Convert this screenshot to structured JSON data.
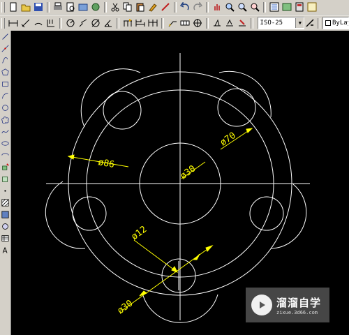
{
  "toolbar_dims": {
    "dimstyle_value": "ISO-25",
    "layer_value": "ByLay"
  },
  "drawing": {
    "dimensions": {
      "d86": "ø86",
      "d70": "ø70",
      "d30_center": "ø30",
      "d12": "ø12",
      "d30_bottom": "ø30"
    }
  },
  "watermark": {
    "brand": "溜溜自学",
    "url": "zixue.3d66.com"
  },
  "icons": {
    "standard_toolbar": [
      "new-icon",
      "open-icon",
      "save-icon",
      "print-icon",
      "print-preview-icon",
      "publish-icon",
      "3d-publish-icon",
      "cut-icon",
      "copy-icon",
      "paste-icon",
      "match-properties-icon",
      "block-editor-icon",
      "undo-icon",
      "redo-icon",
      "pan-icon",
      "zoom-realtime-icon",
      "zoom-window-icon",
      "zoom-previous-icon",
      "properties-icon",
      "design-center-icon",
      "tool-palettes-icon",
      "sheet-set-icon"
    ],
    "dim_toolbar": [
      "linear-dim-icon",
      "aligned-dim-icon",
      "arc-length-icon",
      "ordinate-dim-icon",
      "radius-dim-icon",
      "jogged-dim-icon",
      "diameter-dim-icon",
      "angular-dim-icon",
      "quick-dim-icon",
      "baseline-dim-icon",
      "continue-dim-icon",
      "leader-icon",
      "tolerance-icon",
      "center-mark-icon",
      "dim-edit-icon",
      "dim-text-edit-icon",
      "dim-update-icon",
      "dim-style-icon"
    ],
    "draw_toolbar": [
      "line-icon",
      "construction-line-icon",
      "polyline-icon",
      "polygon-icon",
      "rectangle-icon",
      "arc-icon",
      "circle-icon",
      "revision-cloud-icon",
      "spline-icon",
      "ellipse-icon",
      "ellipse-arc-icon",
      "insert-block-icon",
      "make-block-icon",
      "point-icon",
      "hatch-icon",
      "gradient-icon",
      "region-icon",
      "table-icon",
      "multiline-text-icon"
    ]
  },
  "colors": {
    "canvas": "#000000",
    "geometry": "#ffffff",
    "dimension": "#ffff00",
    "ui_face": "#d4d0c8"
  }
}
